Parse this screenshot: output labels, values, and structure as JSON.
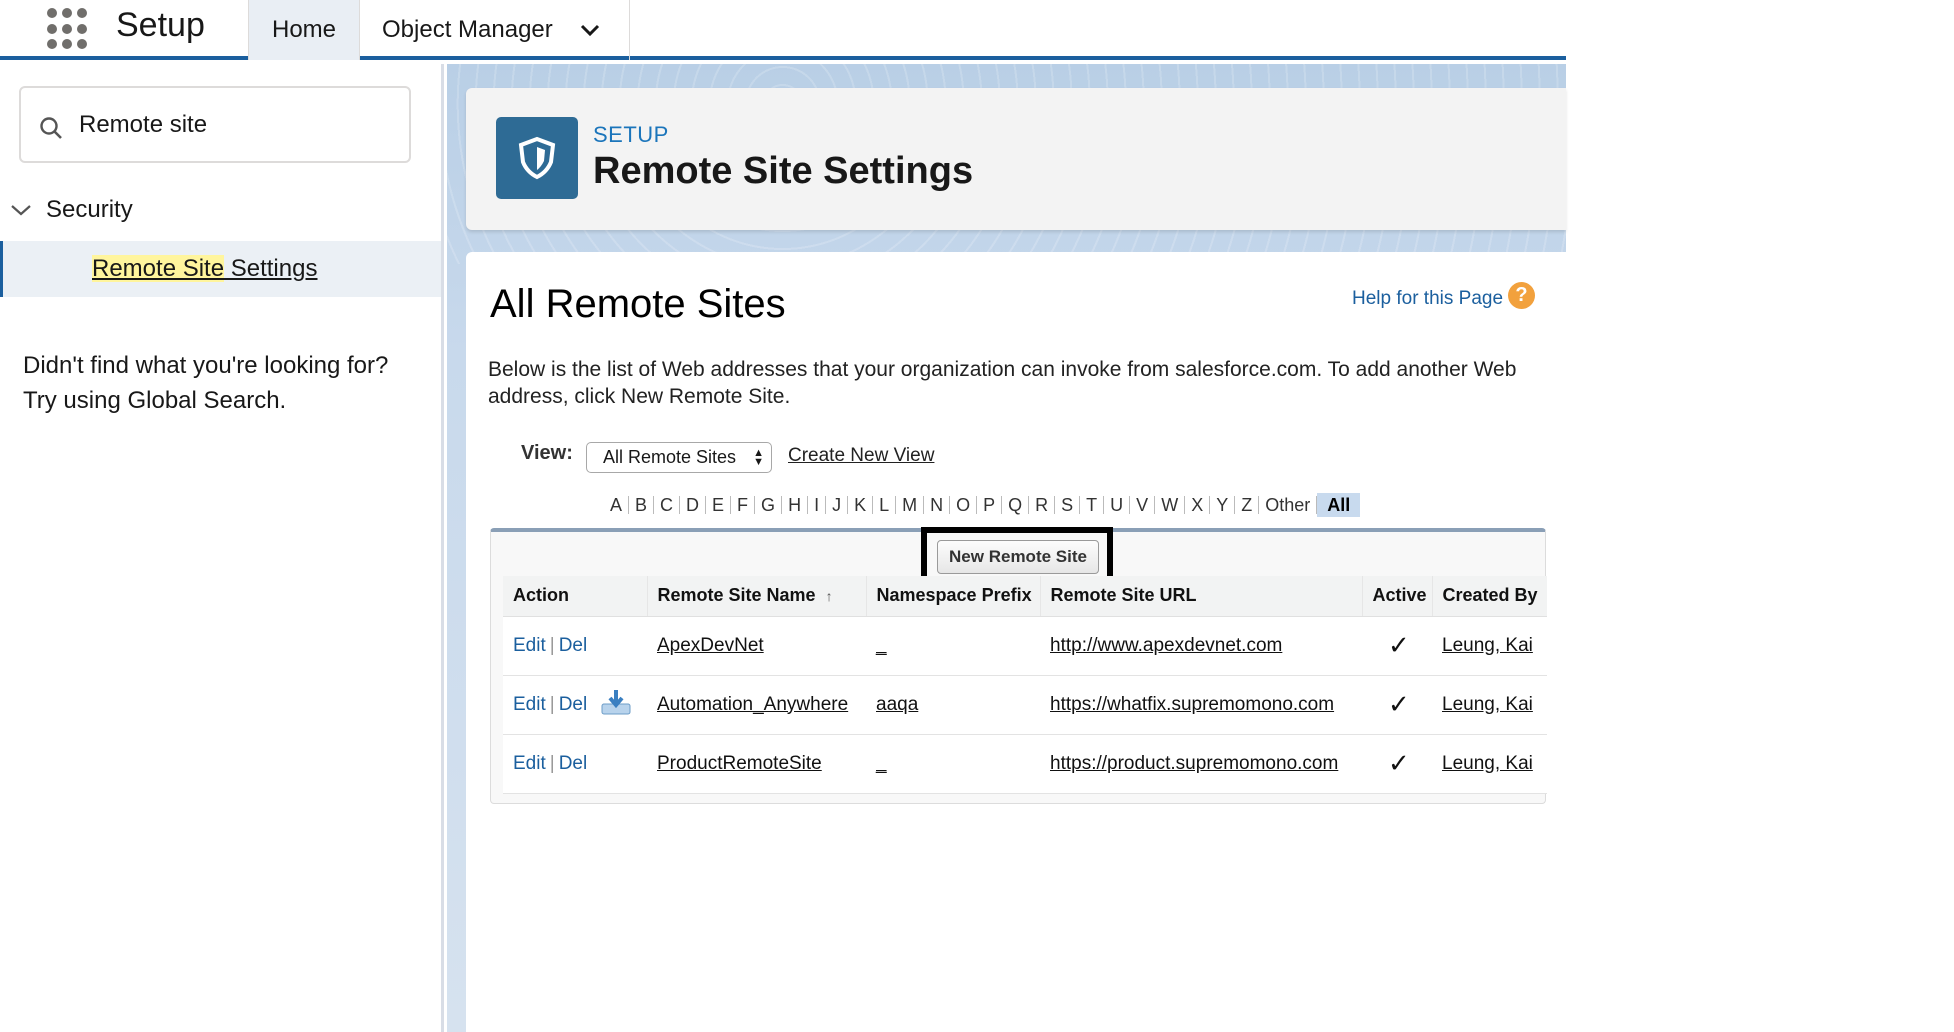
{
  "topbar": {
    "app_title": "Setup",
    "tabs": [
      {
        "label": "Home"
      },
      {
        "label": "Object Manager"
      }
    ]
  },
  "sidebar": {
    "search_value": "Remote site",
    "tree": {
      "section_label": "Security",
      "item_label_highlighted": "Remote Site",
      "item_label_rest": " Settings"
    },
    "not_found_line1": "Didn't find what you're looking for?",
    "not_found_line2": "Try using Global Search."
  },
  "header": {
    "kicker": "SETUP",
    "title": "Remote Site Settings",
    "icon": "shield-icon"
  },
  "content": {
    "heading": "All Remote Sites",
    "help_link": "Help for this Page",
    "help_icon_glyph": "?",
    "description": "Below is the list of Web addresses that your organization can invoke from salesforce.com. To add another Web address, click New Remote Site.",
    "view_label": "View:",
    "view_selected": "All Remote Sites",
    "create_view": "Create New View",
    "alpha": [
      "A",
      "B",
      "C",
      "D",
      "E",
      "F",
      "G",
      "H",
      "I",
      "J",
      "K",
      "L",
      "M",
      "N",
      "O",
      "P",
      "Q",
      "R",
      "S",
      "T",
      "U",
      "V",
      "W",
      "X",
      "Y",
      "Z",
      "Other",
      "All"
    ],
    "alpha_active": "All",
    "new_button": "New Remote Site",
    "columns": [
      "Action",
      "Remote Site Name",
      "Namespace Prefix",
      "Remote Site URL",
      "Active",
      "Created By"
    ],
    "rows": [
      {
        "edit": "Edit",
        "del": "Del",
        "name": "ApexDevNet",
        "prefix": "_",
        "url": "http://www.apexdevnet.com",
        "active": "✓",
        "created_by": "Leung, Kai",
        "installed": false
      },
      {
        "edit": "Edit",
        "del": "Del",
        "name": "Automation_Anywhere",
        "prefix": "aaqa",
        "url": "https://whatfix.supremomono.com",
        "active": "✓",
        "created_by": "Leung, Kai",
        "installed": true
      },
      {
        "edit": "Edit",
        "del": "Del",
        "name": "ProductRemoteSite",
        "prefix": "_",
        "url": "https://product.supremomono.com",
        "active": "✓",
        "created_by": "Leung, Kai",
        "installed": false
      }
    ]
  },
  "colors": {
    "brand_blue": "#1b5f9e",
    "header_icon_bg": "#2e6b95",
    "help_orange": "#f2a13d",
    "search_highlight": "#fff59d"
  }
}
